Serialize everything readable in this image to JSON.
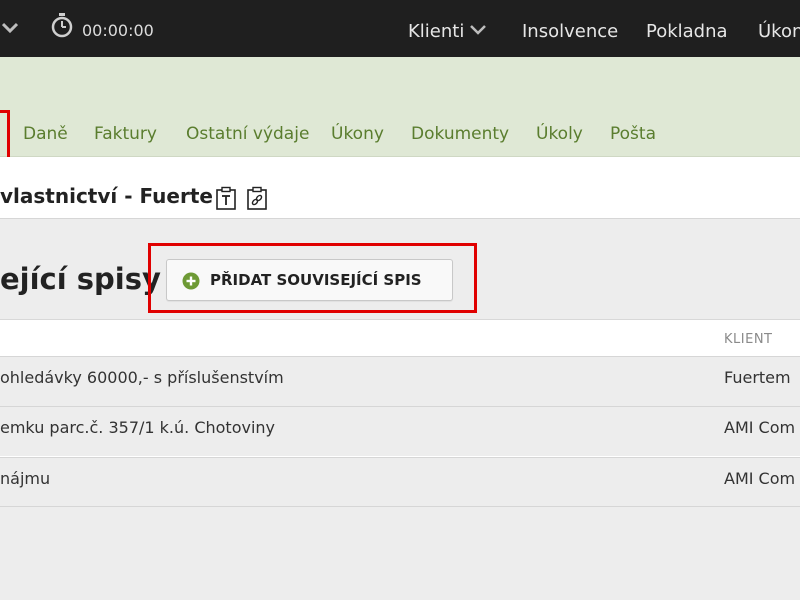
{
  "topbar": {
    "timer": "00:00:00",
    "nav": [
      {
        "label": "Klienti",
        "has_dropdown": true
      },
      {
        "label": "Insolvence"
      },
      {
        "label": "Pokladna"
      },
      {
        "label": "Úkon"
      }
    ]
  },
  "tabs": [
    "Daně",
    "Faktury",
    "Ostatní výdaje",
    "Úkony",
    "Dokumenty",
    "Úkoly",
    "Pošta"
  ],
  "case": {
    "title": "vlastnictví - Fuerte"
  },
  "section": {
    "title": "ející spisy",
    "add_button": "PŘIDAT SOUVISEJÍCÍ SPIS"
  },
  "table": {
    "headers": [
      "",
      "KLIENT"
    ],
    "rows": [
      {
        "name": "ohledávky 60000,- s příslušenstvím",
        "client": "Fuertem"
      },
      {
        "name": "emku parc.č. 357/1 k.ú. Chotoviny",
        "client": "AMI Com"
      },
      {
        "name": "nájmu",
        "client": "AMI Com"
      }
    ]
  },
  "colors": {
    "topbar_bg": "#1f1f1f",
    "green_band": "#dfe8d5",
    "tab_text": "#5a7d2e",
    "highlight_red": "#e00000",
    "plus_icon": "#6e9a35"
  }
}
